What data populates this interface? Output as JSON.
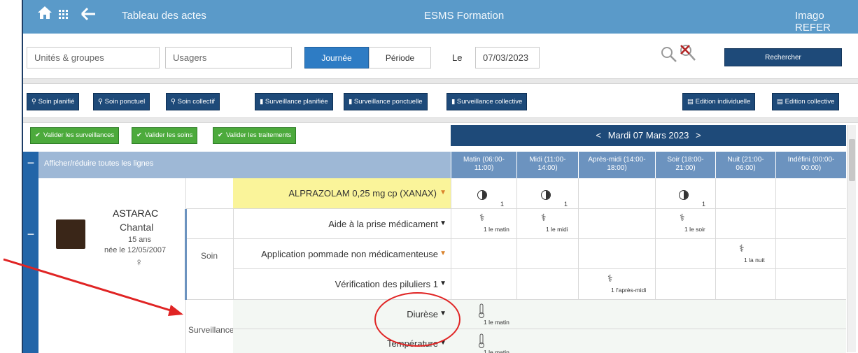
{
  "titlebar": {
    "module": "Tableau des actes",
    "center": "ESMS Formation",
    "right": "Imago REFER"
  },
  "search": {
    "units_placeholder": "Unités & groupes",
    "users_placeholder": "Usagers",
    "mode_day": "Journée",
    "mode_period": "Période",
    "date_label": "Le",
    "date_value": "07/03/2023",
    "search_button": "Rechercher"
  },
  "action_buttons": [
    "Soin planifié",
    "Soin ponctuel",
    "Soin collectif",
    "Surveillance planifiée",
    "Surveillance ponctuelle",
    "Surveillance collective",
    "Edition individuelle",
    "Edition collective"
  ],
  "validate_buttons": [
    "Valider les surveillances",
    "Valider les soins",
    "Valider les traitements"
  ],
  "date_header": {
    "prev": "<",
    "label": "Mardi 07 Mars 2023",
    "next": ">"
  },
  "grid": {
    "toggle_all": "Afficher/réduire toutes les lignes",
    "columns": [
      {
        "l1": "Matin (06:00-",
        "l2": "11:00)"
      },
      {
        "l1": "Midi (11:00-",
        "l2": "14:00)"
      },
      {
        "l1": "Après-midi (14:00-",
        "l2": "18:00)"
      },
      {
        "l1": "Soir (18:00-",
        "l2": "21:00)"
      },
      {
        "l1": "Nuit (21:00-",
        "l2": "06:00)"
      },
      {
        "l1": "Indéfini (00:00-",
        "l2": "00:00)"
      }
    ],
    "patient": {
      "last_name": "ASTARAC",
      "first_name": "Chantal",
      "age": "15 ans",
      "birth": "née le 12/05/2007",
      "gender_icon": "♀"
    },
    "groups": {
      "soin": "Soin",
      "surveillance": "Surveillance"
    },
    "rows": {
      "alprazolam": "ALPRAZOLAM 0,25 mg cp (XANAX)",
      "aide": "Aide à la prise médicament",
      "pommade": "Application pommade non médicamenteuse",
      "piluliers": "Vérification des piluliers 1",
      "diurese": "Diurèse",
      "temperature": "Température"
    },
    "doses": {
      "qty": "1",
      "le_matin": "1 le matin",
      "le_midi": "1 le midi",
      "le_soir": "1 le soir",
      "la_nuit": "1 la nuit",
      "apres_midi": "1 l'après-midi"
    }
  },
  "colors": {
    "titlebar": "#5a9ac9",
    "navy_button": "#1e4a79",
    "green_button": "#4caa3c",
    "highlight_row": "#faf49a",
    "annotation": "#e02424"
  }
}
